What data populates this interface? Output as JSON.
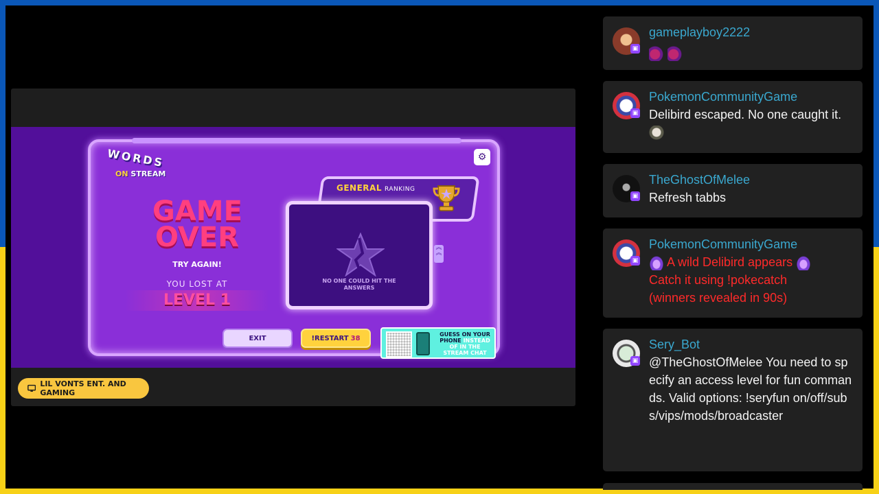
{
  "video": {
    "channel_name": "LIL VONTS ENT. AND GAMING",
    "game": {
      "logo_line1": "WORDS",
      "logo_line2_a": "ON",
      "logo_line2_b": "STREAM",
      "title_line1": "GAME",
      "title_line2": "OVER",
      "subtitle": "TRY AGAIN!",
      "lost_label": "YOU LOST AT",
      "level": "LEVEL 1",
      "ranking_title": "GENERAL",
      "ranking_sub": "RANKING",
      "no_answers": "NO ONE COULD HIT THE ANSWERS",
      "exit_label": "EXIT",
      "restart_label": "!RESTART",
      "restart_count": "38",
      "qr_line1": "GUESS ON YOUR",
      "qr_line2_a": "PHONE",
      "qr_line2_b": "INSTEAD",
      "qr_line3": "OF IN THE",
      "qr_line4": "STREAM CHAT"
    }
  },
  "chat": [
    {
      "username": "gameplayboy2222",
      "text": "",
      "emotes": [
        "bomb-emote",
        "bomb-emote"
      ],
      "avatar_color": "#8a3b2a"
    },
    {
      "username": "PokemonCommunityGame",
      "text": "Delibird escaped. No one caught it.",
      "emotes": [
        "skull-emote"
      ],
      "avatar_color": "#d4313f"
    },
    {
      "username": "TheGhostOfMelee",
      "text": "Refresh tabbs",
      "emotes": [],
      "avatar_color": "#2a2a2a"
    },
    {
      "username": "PokemonCommunityGame",
      "line1": "A wild Delibird appears",
      "line2": "Catch it using !pokecatch",
      "line3": "(winners revealed in 90s)",
      "emotes": [
        "flame-emote",
        "flame-emote"
      ],
      "text_color": "#ff2a2a",
      "avatar_color": "#d4313f"
    },
    {
      "username": "Sery_Bot",
      "text": "@TheGhostOfMelee You need to specify an access level for fun commands. Valid options: !seryfun on/off/subs/vips/mods/broadcaster",
      "emotes": [],
      "avatar_color": "#e9e9e9"
    }
  ],
  "colors": {
    "flag_blue": "#0a57b8",
    "flag_yellow": "#f7d117",
    "username": "#3aa8cf",
    "twitch_purple": "#9146ff"
  }
}
